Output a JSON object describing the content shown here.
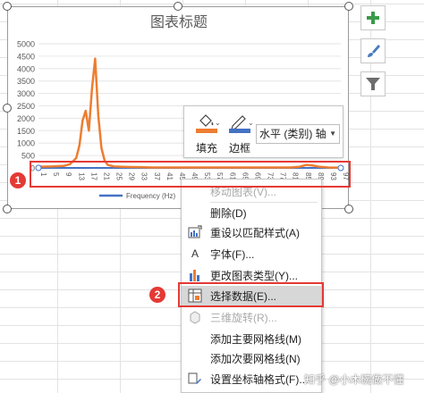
{
  "chart": {
    "title": "图表标题",
    "legend_label": "Frequency (Hz)",
    "y_ticks": [
      "5000",
      "4500",
      "4000",
      "3500",
      "3000",
      "2500",
      "2000",
      "1500",
      "1000",
      "500",
      "0"
    ],
    "x_ticks": [
      "1",
      "5",
      "9",
      "13",
      "17",
      "21",
      "25",
      "29",
      "33",
      "37",
      "41",
      "45",
      "49",
      "53",
      "57",
      "61",
      "65",
      "69",
      "73",
      "77",
      "81",
      "85",
      "89",
      "93",
      "97"
    ],
    "series_color": "#ed7d31",
    "axis_line_color": "#4472c4"
  },
  "chart_data": {
    "type": "line",
    "title": "图表标题",
    "legend": "bottom",
    "ylim": [
      0,
      5000
    ],
    "categories": [
      "1",
      "5",
      "9",
      "13",
      "17",
      "21",
      "25",
      "29",
      "33",
      "37",
      "41",
      "45",
      "49",
      "53",
      "57",
      "61",
      "65",
      "69",
      "73",
      "77",
      "81",
      "85",
      "89",
      "93",
      "97"
    ],
    "series": [
      {
        "name": "Frequency (Hz)",
        "color": "#4472c4",
        "x": [
          1,
          97
        ],
        "values": [
          0,
          0
        ]
      },
      {
        "color": "#ed7d31",
        "x": [
          1,
          5,
          9,
          11,
          13,
          14,
          15,
          16,
          17,
          18,
          19,
          20,
          21,
          22,
          23,
          25,
          29,
          33,
          37,
          41,
          45,
          49,
          53,
          57,
          61,
          65,
          69,
          73,
          77,
          81,
          84,
          86,
          88,
          90,
          93,
          97
        ],
        "values": [
          50,
          60,
          80,
          150,
          400,
          900,
          1900,
          2300,
          1500,
          3200,
          4400,
          2100,
          800,
          300,
          120,
          60,
          40,
          30,
          20,
          20,
          20,
          20,
          20,
          20,
          20,
          20,
          20,
          20,
          20,
          20,
          50,
          120,
          100,
          50,
          20,
          10
        ]
      }
    ]
  },
  "side_buttons": {
    "elements_icon": "plus-icon",
    "styles_icon": "brush-icon",
    "filter_icon": "funnel-icon"
  },
  "toolbar": {
    "fill_label": "填充",
    "border_label": "边框",
    "fill_color": "#ed7d31",
    "border_color": "#4472c4",
    "element_select": "水平 (类别) 轴"
  },
  "context_menu": {
    "items": [
      {
        "label": "移动图表(V)...",
        "disabled": true
      },
      {
        "label": "删除(D)",
        "disabled": false
      },
      {
        "label": "重设以匹配样式(A)",
        "disabled": false
      },
      {
        "label": "字体(F)...",
        "disabled": false,
        "icon_text": "A"
      },
      {
        "label": "更改图表类型(Y)...",
        "disabled": false
      },
      {
        "label": "选择数据(E)...",
        "disabled": false,
        "highlighted": true
      },
      {
        "label": "三维旋转(R)...",
        "disabled": true
      },
      {
        "label": "添加主要网格线(M)",
        "disabled": false
      },
      {
        "label": "添加次要网格线(N)",
        "disabled": false
      },
      {
        "label": "设置坐标轴格式(F)...",
        "disabled": false
      }
    ]
  },
  "annotations": {
    "badge1": "1",
    "badge2": "2",
    "highlight_color": "#e53935"
  },
  "watermark": "知乎 @小木碗做不懂"
}
